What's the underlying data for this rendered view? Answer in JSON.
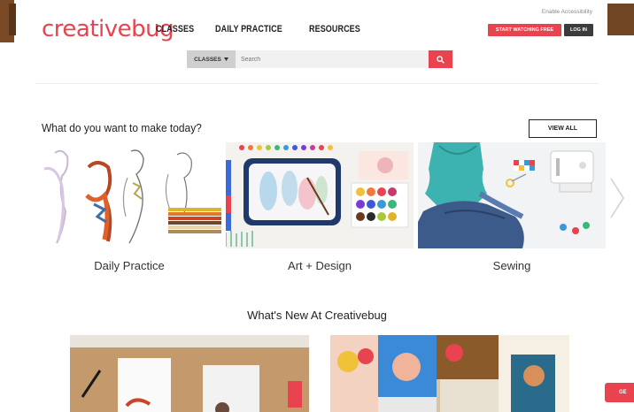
{
  "header": {
    "logo": "creativebug",
    "nav": [
      "CLASSES",
      "DAILY PRACTICE",
      "RESOURCES"
    ],
    "accessibility_link": "Enable Accessibility",
    "start_button": "START WATCHING FREE",
    "login_button": "LOG IN"
  },
  "search": {
    "category_label": "CLASSES",
    "placeholder": "Search",
    "button_icon": "search-icon"
  },
  "make_section": {
    "heading": "What do you want to make today?",
    "view_all": "VIEW ALL",
    "categories": [
      {
        "label": "Daily Practice"
      },
      {
        "label": "Art + Design"
      },
      {
        "label": "Sewing"
      }
    ],
    "next_icon": "chevron-right-icon"
  },
  "whats_new": {
    "heading": "What's New At Creativebug"
  },
  "floating_tab": "GE",
  "colors": {
    "brand": "#e8434f",
    "dark_button": "#3c3c3c"
  }
}
